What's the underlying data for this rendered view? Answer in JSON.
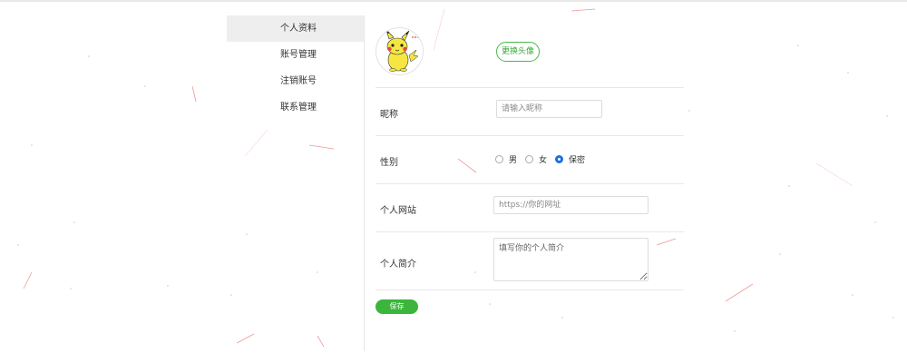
{
  "sidebar": {
    "items": [
      {
        "label": "个人资料",
        "active": true
      },
      {
        "label": "账号管理",
        "active": false
      },
      {
        "label": "注销账号",
        "active": false
      },
      {
        "label": "联系管理",
        "active": false
      }
    ]
  },
  "profile": {
    "avatar_icon": "pikachu-avatar",
    "change_avatar_label": "更换头像",
    "nickname": {
      "label": "昵称",
      "placeholder": "请输入昵称",
      "value": ""
    },
    "gender": {
      "label": "性别",
      "options": [
        "男",
        "女",
        "保密"
      ],
      "selected": "保密"
    },
    "website": {
      "label": "个人网站",
      "placeholder": "https://你的网址",
      "value": ""
    },
    "bio": {
      "label": "个人简介",
      "placeholder": "填写你的个人简介",
      "value": ""
    },
    "save_label": "保存"
  },
  "colors": {
    "accent_green": "#3bb53b",
    "radio_blue": "#1f6fe0",
    "sidebar_active_bg": "#eeeeee",
    "particle_line": "#e98a8a"
  }
}
